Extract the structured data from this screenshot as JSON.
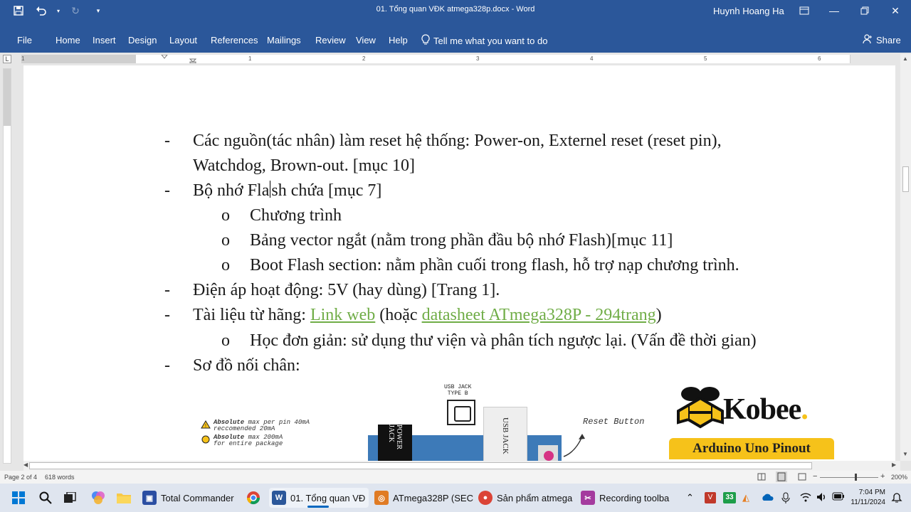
{
  "window": {
    "title": "01. Tổng quan VĐK atmega328p.docx  -  Word",
    "user": "Huynh Hoang Ha"
  },
  "ribbon": {
    "tabs": [
      "File",
      "Home",
      "Insert",
      "Design",
      "Layout",
      "References",
      "Mailings",
      "Review",
      "View",
      "Help"
    ],
    "tell_me": "Tell me what you want to do",
    "share": "Share"
  },
  "ruler": {
    "numbers": [
      "1",
      "1",
      "2",
      "3",
      "4",
      "5",
      "6"
    ],
    "corner": "L"
  },
  "document": {
    "line1": "Các nguồn(tác nhân) làm reset hệ thống: Power-on, Externel reset (reset pin),",
    "line2": "Watchdog, Brown-out. [mục 10]",
    "line3_a": "Bộ nhớ Fla",
    "line3_b": "sh chứa [mục 7]",
    "line4": "Chương trình",
    "line5": "Bảng vector ngắt (nằm trong phần đầu bộ nhớ Flash)[mục 11]",
    "line6": "Boot Flash section: nằm phần cuối trong flash, hỗ trợ nạp chương trình.",
    "line7": "Điện áp hoạt động: 5V (hay dùng) [Trang 1].",
    "line8_pre": "Tài liệu từ hãng: ",
    "line8_link1": "Link web",
    "line8_mid": " (hoặc ",
    "line8_link2": "datasheet ATmega328P - 294trang",
    "line8_post": ")",
    "line9": "Học đơn giản: sử dụng thư viện và phân tích ngược lại. (Vấn đề thời gian)",
    "line10": "Sơ đồ nối chân:",
    "dash": "-",
    "circle": "o"
  },
  "figure": {
    "note1_bold": "Absolute",
    "note1_rest": " max per pin 40mA",
    "note1_line2": "reccomended 20mA",
    "note2_bold": "Absolute",
    "note2_rest": " max 200mA",
    "note2_line2": "for entire package",
    "usb_label_1": "USB JACK",
    "usb_label_2": "TYPE B",
    "power_jack": "POWER JACK",
    "usb_jack": "USB JACK",
    "reset_button": "Reset Button",
    "brand": "Kobee",
    "brand_dot": ".",
    "banner": "Arduino Uno Pinout"
  },
  "status": {
    "page": "Page 2 of 4",
    "words": "618 words",
    "zoom": "200%",
    "zoom_minus": "−",
    "zoom_plus": "+"
  },
  "taskbar": {
    "apps": [
      {
        "label": "Total Commander"
      },
      {
        "label": "01. Tổng quan VĐ"
      },
      {
        "label": "ATmega328P (SEC"
      },
      {
        "label": "Sản phẩm atmega"
      },
      {
        "label": "Recording toolba"
      }
    ],
    "time": "7:04 PM",
    "date": "11/11/2024",
    "badge": "33"
  },
  "colors": {
    "accent": "#2b579a",
    "link": "#70ad47",
    "kobee_yellow": "#f6c21a"
  }
}
